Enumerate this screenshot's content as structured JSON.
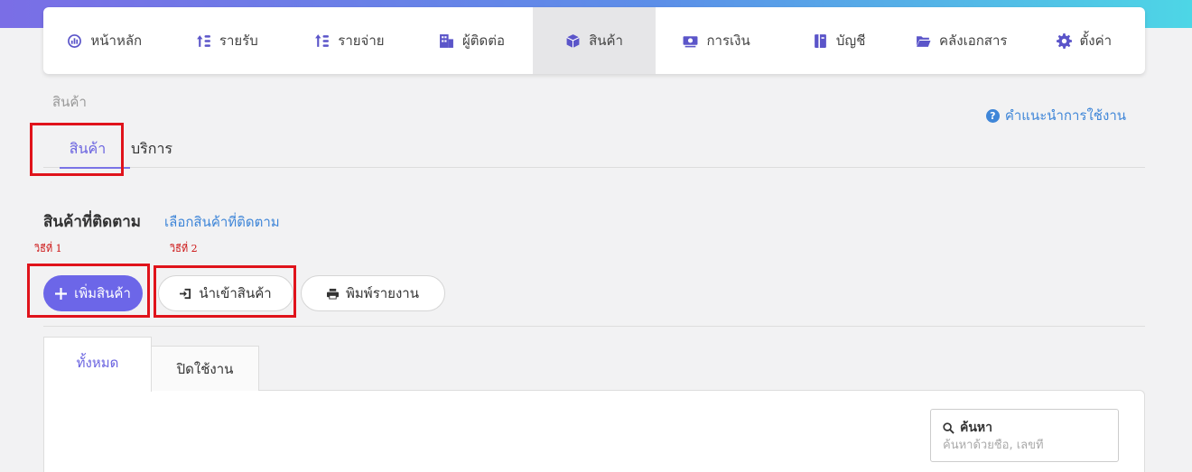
{
  "nav": {
    "items": [
      {
        "label": "หน้าหลัก",
        "icon": "dashboard-gauge-icon"
      },
      {
        "label": "รายรับ",
        "icon": "income-sort-icon"
      },
      {
        "label": "รายจ่าย",
        "icon": "expense-sort-icon"
      },
      {
        "label": "ผู้ติดต่อ",
        "icon": "contacts-building-icon"
      },
      {
        "label": "สินค้า",
        "icon": "product-box-icon"
      },
      {
        "label": "การเงิน",
        "icon": "finance-money-icon"
      },
      {
        "label": "บัญชี",
        "icon": "accounting-book-icon"
      },
      {
        "label": "คลังเอกสาร",
        "icon": "folder-open-icon"
      },
      {
        "label": "ตั้งค่า",
        "icon": "gear-icon"
      }
    ],
    "active_index": 4
  },
  "breadcrumb": "สินค้า",
  "help_link": "คำแนะนำการใช้งาน",
  "subtabs": {
    "products": "สินค้า",
    "services": "บริการ"
  },
  "section": {
    "title": "สินค้าที่ติดตาม",
    "link": "เลือกสินค้าที่ติดตาม"
  },
  "annotations": {
    "step1": "วิธีที่ 1",
    "step2": "วิธีที่ 2"
  },
  "buttons": {
    "add_product": "เพิ่มสินค้า",
    "import_product": "นำเข้าสินค้า",
    "print_report": "พิมพ์รายงาน"
  },
  "list_tabs": {
    "all": "ทั้งหมด",
    "inactive": "ปิดใช้งาน"
  },
  "search": {
    "label": "ค้นหา",
    "placeholder": "ค้นหาด้วยชื่อ, เลขที่"
  },
  "colors": {
    "accent": "#6c66e8",
    "link": "#3f86d8",
    "annotation": "#e0131b"
  }
}
